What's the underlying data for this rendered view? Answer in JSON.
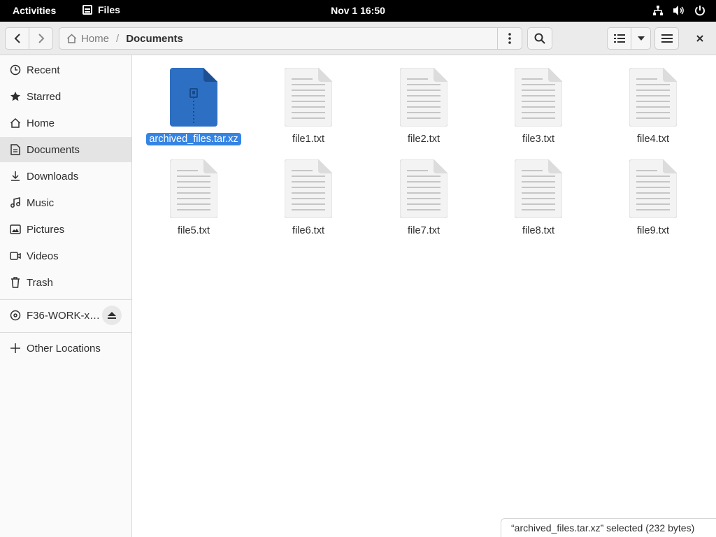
{
  "topbar": {
    "activities": "Activities",
    "app_name": "Files",
    "clock": "Nov 1  16:50"
  },
  "headerbar": {
    "path": {
      "home": "Home",
      "current": "Documents"
    }
  },
  "sidebar": {
    "items": [
      {
        "label": "Recent",
        "icon": "clock-icon"
      },
      {
        "label": "Starred",
        "icon": "star-icon"
      },
      {
        "label": "Home",
        "icon": "home-icon"
      },
      {
        "label": "Documents",
        "icon": "document-icon",
        "active": true
      },
      {
        "label": "Downloads",
        "icon": "download-icon"
      },
      {
        "label": "Music",
        "icon": "music-icon"
      },
      {
        "label": "Pictures",
        "icon": "picture-icon"
      },
      {
        "label": "Videos",
        "icon": "video-icon"
      },
      {
        "label": "Trash",
        "icon": "trash-icon"
      }
    ],
    "drive": {
      "label": "F36-WORK-x…",
      "icon": "disc-icon"
    },
    "other": {
      "label": "Other Locations",
      "icon": "plus-icon"
    }
  },
  "files": [
    {
      "name": "archived_files.tar.xz",
      "type": "archive",
      "selected": true
    },
    {
      "name": "file1.txt",
      "type": "text"
    },
    {
      "name": "file2.txt",
      "type": "text"
    },
    {
      "name": "file3.txt",
      "type": "text"
    },
    {
      "name": "file4.txt",
      "type": "text"
    },
    {
      "name": "file5.txt",
      "type": "text"
    },
    {
      "name": "file6.txt",
      "type": "text"
    },
    {
      "name": "file7.txt",
      "type": "text"
    },
    {
      "name": "file8.txt",
      "type": "text"
    },
    {
      "name": "file9.txt",
      "type": "text"
    }
  ],
  "status": "“archived_files.tar.xz” selected  (232 bytes)",
  "colors": {
    "accent": "#3584e4",
    "archive_icon": "#2d6fc2"
  }
}
